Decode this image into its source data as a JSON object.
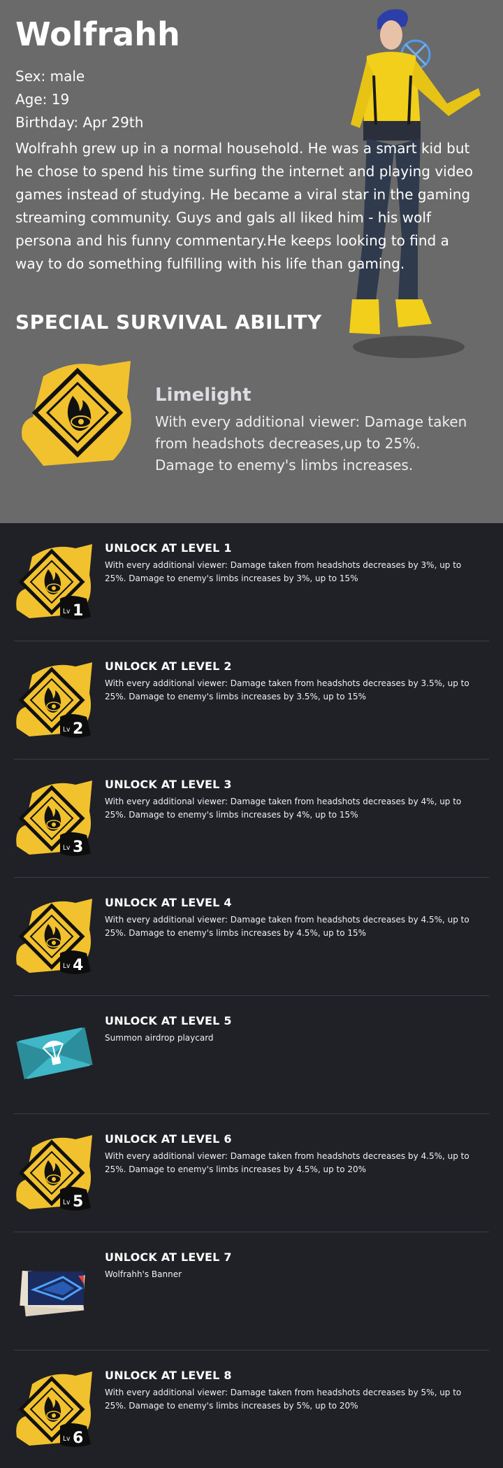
{
  "character": {
    "name": "Wolfrahh",
    "sex": "Sex: male",
    "age": "Age: 19",
    "birthday": "Birthday: Apr 29th",
    "bio": "Wolfrahh grew up in a normal household. He was a smart kid but he chose to spend his time surfing the internet and playing video games instead of studying. He became a viral star in the gaming streaming community. Guys and gals all liked him - his wolf persona and his funny commentary.He keeps looking to find a way to do something fulfilling with his life than gaming."
  },
  "ability": {
    "section_title": "SPECIAL SURVIVAL ABILITY",
    "name": "Limelight",
    "description": "With every additional viewer: Damage taken from headshots decreases,up to 25%. Damage to enemy's limbs increases."
  },
  "levels": [
    {
      "title": "UNLOCK AT LEVEL 1",
      "desc": "With every additional viewer: Damage taken from headshots decreases by 3%, up to 25%. Damage to enemy's limbs increases by 3%, up to 15%",
      "icon": "ability-icon",
      "badge": "1"
    },
    {
      "title": "UNLOCK AT LEVEL 2",
      "desc": "With every additional viewer: Damage taken from headshots decreases by 3.5%, up to 25%. Damage to enemy's limbs increases by 3.5%, up to 15%",
      "icon": "ability-icon",
      "badge": "2"
    },
    {
      "title": "UNLOCK AT LEVEL 3",
      "desc": "With every additional viewer: Damage taken from headshots decreases by 4%, up to 25%. Damage to enemy's limbs increases by 4%, up to 15%",
      "icon": "ability-icon",
      "badge": "3"
    },
    {
      "title": "UNLOCK AT LEVEL 4",
      "desc": "With every additional viewer: Damage taken from headshots decreases by 4.5%, up to 25%. Damage to enemy's limbs increases by 4.5%, up to 15%",
      "icon": "ability-icon",
      "badge": "4"
    },
    {
      "title": "UNLOCK AT LEVEL 5",
      "desc": "Summon airdrop playcard",
      "icon": "airdrop-card-icon",
      "badge": ""
    },
    {
      "title": "UNLOCK AT LEVEL 6",
      "desc": "With every additional viewer: Damage taken from headshots decreases by 4.5%, up to 25%. Damage to enemy's limbs increases by 4.5%, up to 20%",
      "icon": "ability-icon",
      "badge": "5"
    },
    {
      "title": "UNLOCK AT LEVEL 7",
      "desc": "Wolfrahh's Banner",
      "icon": "banner-icon",
      "badge": ""
    },
    {
      "title": "UNLOCK AT LEVEL 8",
      "desc": "With every additional viewer: Damage taken from headshots decreases by 5%, up to 25%. Damage to enemy's limbs increases by 5%, up to 20%",
      "icon": "ability-icon",
      "badge": "6"
    }
  ],
  "lv_prefix": "Lv",
  "colors": {
    "hero_bg": "#6a6a6a",
    "page_bg": "#1f2126",
    "ability_yellow": "#f2c12e",
    "card_teal": "#3fb7c6"
  }
}
